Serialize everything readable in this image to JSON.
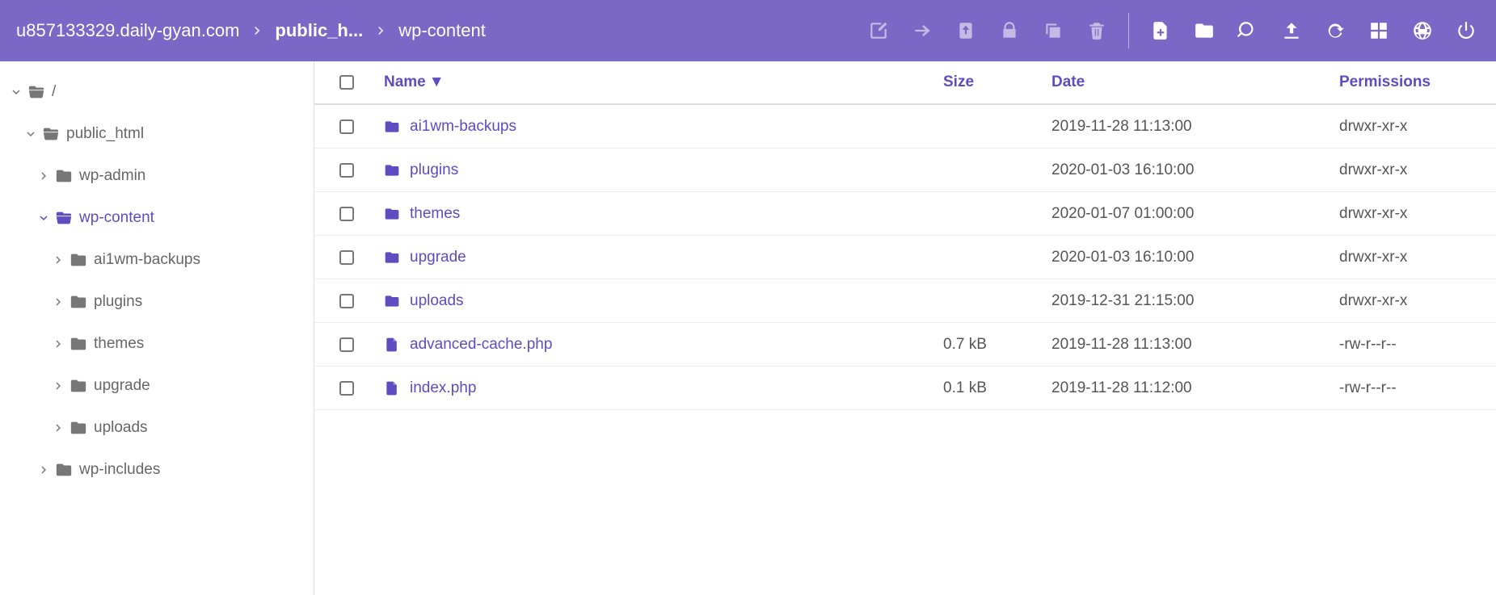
{
  "header": {
    "breadcrumb": [
      {
        "label": "u857133329.daily-gyan.com",
        "strong": false
      },
      {
        "label": "public_h...",
        "strong": true
      },
      {
        "label": "wp-content",
        "strong": false
      }
    ],
    "actions_left": [
      {
        "key": "edit",
        "icon": "edit-square",
        "enabled": false
      },
      {
        "key": "move",
        "icon": "arrow-right",
        "enabled": false
      },
      {
        "key": "download",
        "icon": "download",
        "enabled": false
      },
      {
        "key": "permissions",
        "icon": "lock",
        "enabled": false
      },
      {
        "key": "copy",
        "icon": "copy",
        "enabled": false
      },
      {
        "key": "delete",
        "icon": "trash",
        "enabled": false
      }
    ],
    "actions_right": [
      {
        "key": "new-file",
        "icon": "file-plus",
        "enabled": true
      },
      {
        "key": "new-folder",
        "icon": "folder-plus",
        "enabled": true
      },
      {
        "key": "search",
        "icon": "search",
        "enabled": true
      },
      {
        "key": "upload",
        "icon": "cloud-up",
        "enabled": true
      },
      {
        "key": "refresh",
        "icon": "refresh",
        "enabled": true
      },
      {
        "key": "select-all",
        "icon": "grid",
        "enabled": true
      },
      {
        "key": "language",
        "icon": "globe",
        "enabled": true
      },
      {
        "key": "power",
        "icon": "power",
        "enabled": true
      }
    ]
  },
  "tree": [
    {
      "depth": 0,
      "expanded": true,
      "label": "/",
      "icon": "folder-open",
      "active": false
    },
    {
      "depth": 1,
      "expanded": true,
      "label": "public_html",
      "icon": "folder-open",
      "active": false
    },
    {
      "depth": 2,
      "expanded": false,
      "label": "wp-admin",
      "icon": "folder",
      "active": false
    },
    {
      "depth": 2,
      "expanded": true,
      "label": "wp-content",
      "icon": "folder-open",
      "active": true
    },
    {
      "depth": 3,
      "expanded": false,
      "label": "ai1wm-backups",
      "icon": "folder",
      "active": false
    },
    {
      "depth": 3,
      "expanded": false,
      "label": "plugins",
      "icon": "folder",
      "active": false
    },
    {
      "depth": 3,
      "expanded": false,
      "label": "themes",
      "icon": "folder",
      "active": false
    },
    {
      "depth": 3,
      "expanded": false,
      "label": "upgrade",
      "icon": "folder",
      "active": false
    },
    {
      "depth": 3,
      "expanded": false,
      "label": "uploads",
      "icon": "folder",
      "active": false
    },
    {
      "depth": 2,
      "expanded": false,
      "label": "wp-includes",
      "icon": "folder",
      "active": false
    }
  ],
  "list": {
    "columns": {
      "name": "Name",
      "size": "Size",
      "date": "Date",
      "permissions": "Permissions"
    },
    "sort_indicator": "▼",
    "rows": [
      {
        "type": "dir",
        "name": "ai1wm-backups",
        "size": "",
        "date": "2019-11-28 11:13:00",
        "perm": "drwxr-xr-x"
      },
      {
        "type": "dir",
        "name": "plugins",
        "size": "",
        "date": "2020-01-03 16:10:00",
        "perm": "drwxr-xr-x"
      },
      {
        "type": "dir",
        "name": "themes",
        "size": "",
        "date": "2020-01-07 01:00:00",
        "perm": "drwxr-xr-x"
      },
      {
        "type": "dir",
        "name": "upgrade",
        "size": "",
        "date": "2020-01-03 16:10:00",
        "perm": "drwxr-xr-x"
      },
      {
        "type": "dir",
        "name": "uploads",
        "size": "",
        "date": "2019-12-31 21:15:00",
        "perm": "drwxr-xr-x"
      },
      {
        "type": "file",
        "name": "advanced-cache.php",
        "size": "0.7 kB",
        "date": "2019-11-28 11:13:00",
        "perm": "-rw-r--r--"
      },
      {
        "type": "file",
        "name": "index.php",
        "size": "0.1 kB",
        "date": "2019-11-28 11:12:00",
        "perm": "-rw-r--r--"
      }
    ]
  }
}
